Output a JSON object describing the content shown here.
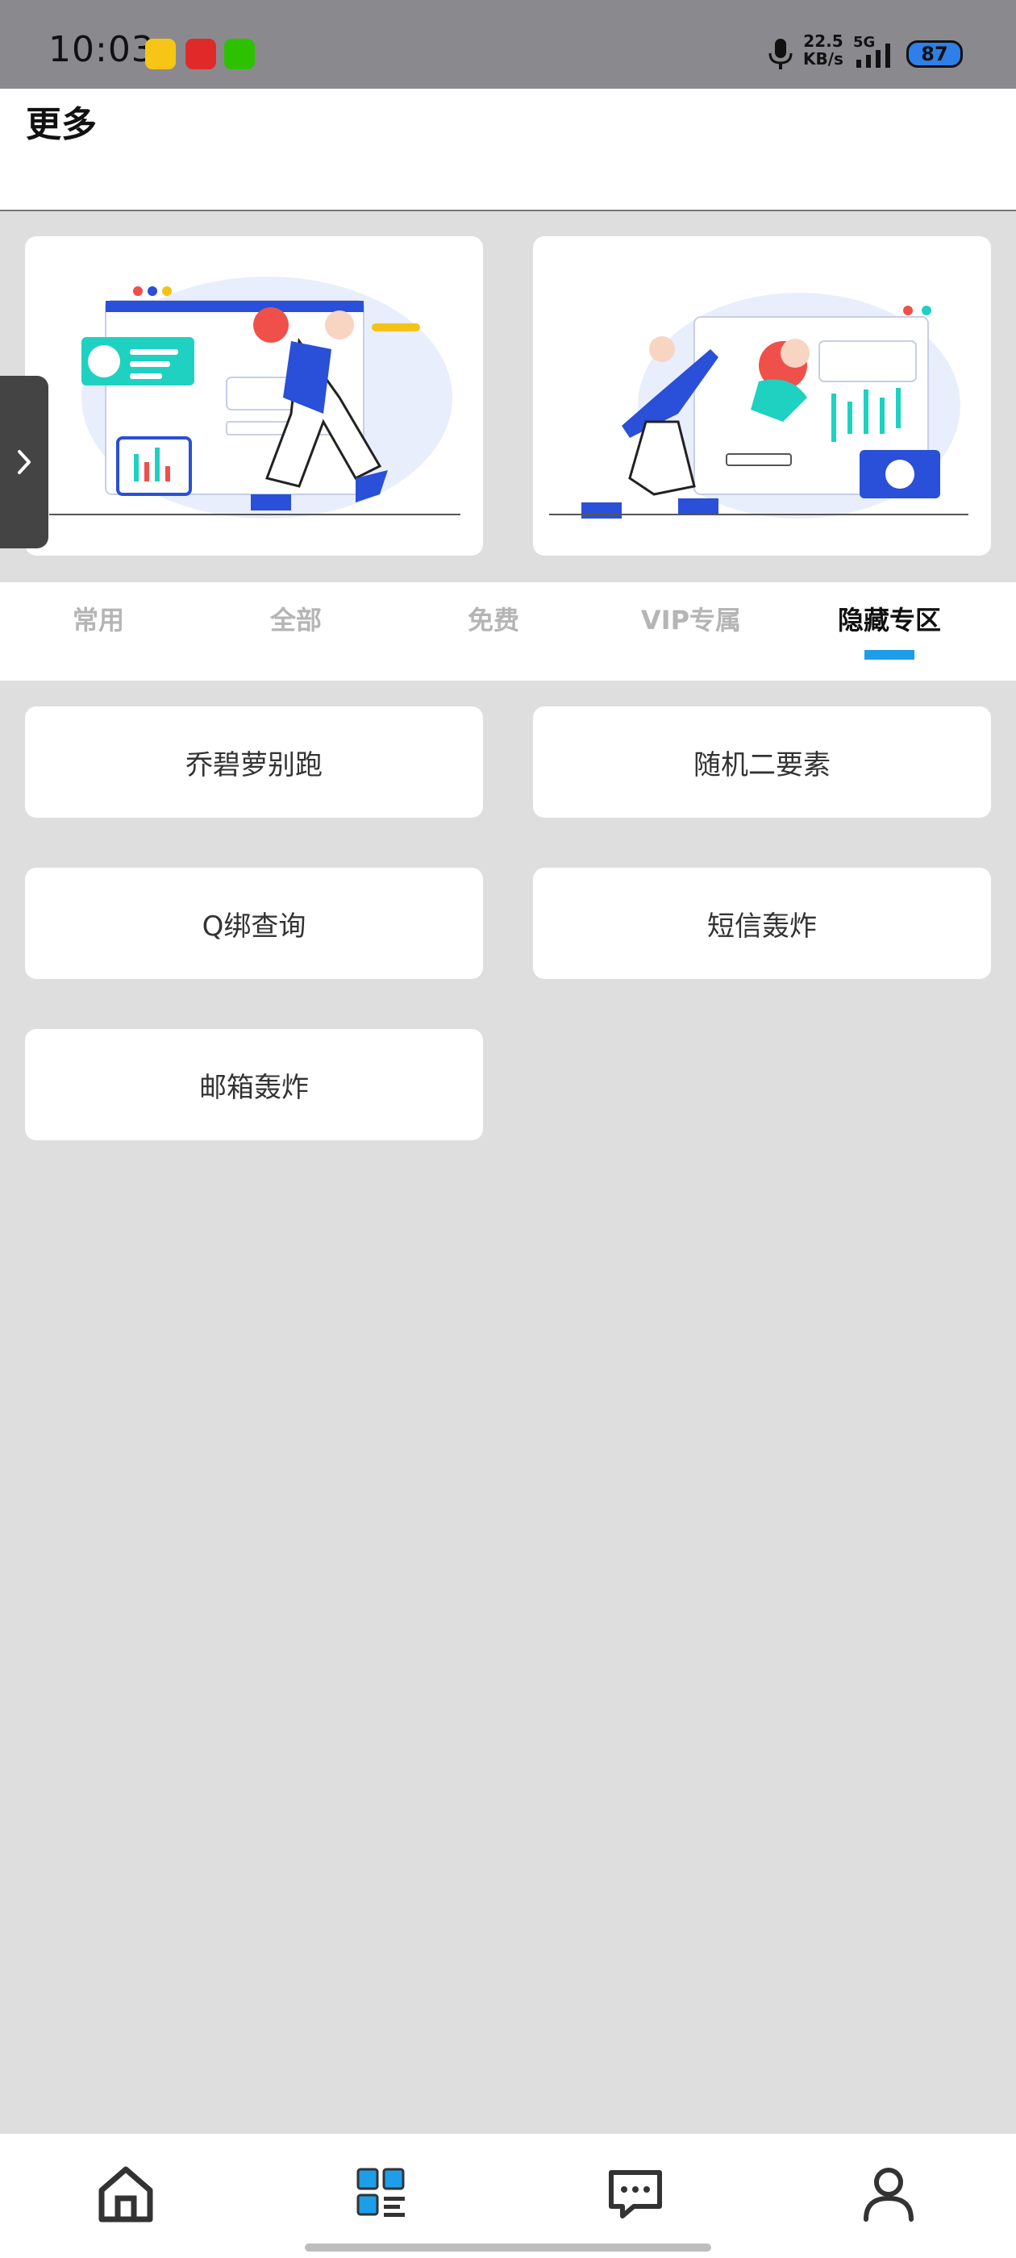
{
  "status_bar": {
    "time": "10:03",
    "net_speed_value": "22.5",
    "net_speed_unit": "KB/s",
    "network": "5G",
    "battery": "87",
    "icons": [
      "app-icon",
      "taobao-icon",
      "wechat-icon",
      "mic-icon",
      "signal-icon",
      "battery-icon"
    ]
  },
  "header": {
    "title": "更多"
  },
  "tabs": [
    {
      "label": "常用",
      "active": false
    },
    {
      "label": "全部",
      "active": false
    },
    {
      "label": "免费",
      "active": false
    },
    {
      "label": "VIP专属",
      "active": false
    },
    {
      "label": "隐藏专区",
      "active": true
    }
  ],
  "grid": [
    {
      "label": "乔碧萝别跑"
    },
    {
      "label": "随机二要素"
    },
    {
      "label": "Q绑查询"
    },
    {
      "label": "短信轰炸"
    },
    {
      "label": "邮箱轰炸"
    }
  ],
  "colors": {
    "accent": "#1e9de8",
    "illustration_blue": "#2a4fd8",
    "illustration_teal": "#1fd1c1",
    "background": "#dedede"
  },
  "bottom_nav": {
    "items": [
      "home-icon",
      "apps-icon",
      "message-icon",
      "profile-icon"
    ],
    "active": "apps-icon"
  }
}
